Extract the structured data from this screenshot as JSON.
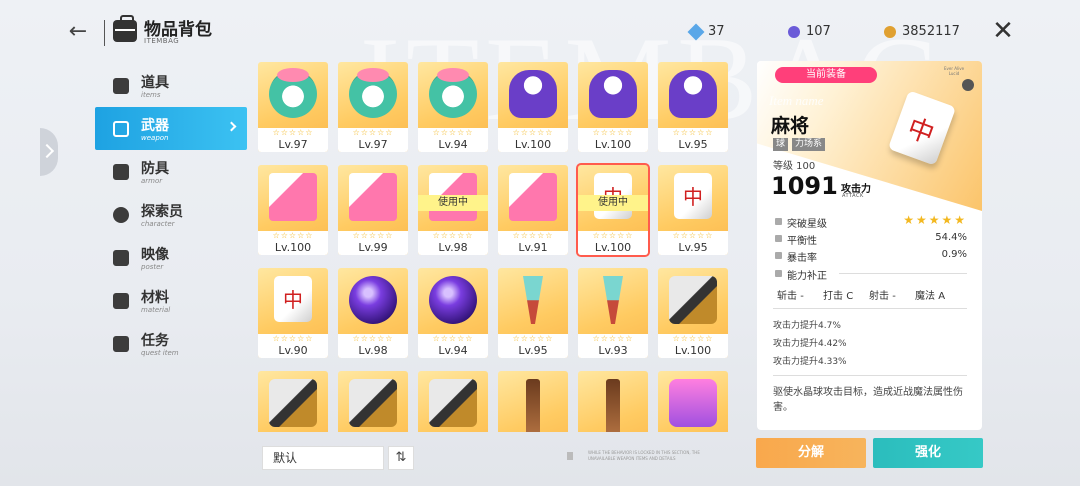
{
  "header": {
    "title": "物品背包",
    "subtitle": "ITEMBAG",
    "currency": [
      {
        "icon": "diamond-icon",
        "value": "37",
        "color": "#5aa7e8"
      },
      {
        "icon": "purple-orb-icon",
        "value": "107",
        "color": "#6b5bd8"
      },
      {
        "icon": "gold-coin-icon",
        "value": "3852117",
        "color": "#e0a030"
      }
    ]
  },
  "nav": [
    {
      "cn": "道具",
      "en": "items",
      "icon": "items-icon",
      "active": false
    },
    {
      "cn": "武器",
      "en": "weapon",
      "icon": "weapon-icon",
      "active": true
    },
    {
      "cn": "防具",
      "en": "armor",
      "icon": "armor-icon",
      "active": false
    },
    {
      "cn": "探索员",
      "en": "character",
      "icon": "character-icon",
      "active": false
    },
    {
      "cn": "映像",
      "en": "poster",
      "icon": "poster-icon",
      "active": false
    },
    {
      "cn": "材料",
      "en": "material",
      "icon": "material-icon",
      "active": false
    },
    {
      "cn": "任务",
      "en": "quest item",
      "icon": "quest-icon",
      "active": false
    }
  ],
  "items": [
    {
      "art": "pig",
      "lv": "Lv.97",
      "inuse": ""
    },
    {
      "art": "pig",
      "lv": "Lv.97",
      "inuse": ""
    },
    {
      "art": "pig",
      "lv": "Lv.94",
      "inuse": ""
    },
    {
      "art": "doll",
      "lv": "Lv.100",
      "inuse": ""
    },
    {
      "art": "doll",
      "lv": "Lv.100",
      "inuse": ""
    },
    {
      "art": "doll",
      "lv": "Lv.95",
      "inuse": ""
    },
    {
      "art": "cube",
      "lv": "Lv.100",
      "inuse": ""
    },
    {
      "art": "cube",
      "lv": "Lv.99",
      "inuse": ""
    },
    {
      "art": "cube",
      "lv": "Lv.98",
      "inuse": "使用中"
    },
    {
      "art": "cube",
      "lv": "Lv.91",
      "inuse": ""
    },
    {
      "art": "tile",
      "lv": "Lv.100",
      "inuse": "使用中",
      "selected": true
    },
    {
      "art": "tile",
      "lv": "Lv.95",
      "inuse": ""
    },
    {
      "art": "tile",
      "lv": "Lv.90",
      "inuse": ""
    },
    {
      "art": "orb",
      "lv": "Lv.98",
      "inuse": ""
    },
    {
      "art": "orb",
      "lv": "Lv.94",
      "inuse": ""
    },
    {
      "art": "wand",
      "lv": "Lv.95",
      "inuse": ""
    },
    {
      "art": "wand",
      "lv": "Lv.93",
      "inuse": ""
    },
    {
      "art": "horn",
      "lv": "Lv.100",
      "inuse": ""
    },
    {
      "art": "horn",
      "lv": "",
      "inuse": ""
    },
    {
      "art": "horn",
      "lv": "",
      "inuse": ""
    },
    {
      "art": "horn",
      "lv": "",
      "inuse": ""
    },
    {
      "art": "gun",
      "lv": "",
      "inuse": ""
    },
    {
      "art": "gun",
      "lv": "",
      "inuse": ""
    },
    {
      "art": "toy",
      "lv": "",
      "inuse": ""
    }
  ],
  "stars_text": "☆☆☆☆☆",
  "sort": {
    "label": "默认",
    "order_icon": "⇅"
  },
  "notice": "WHILE THE BEHAVIOR IS LOCKED IN THIS SECTION, THE UNAVAILABLE WEAPON ITEMS AND DETAILS",
  "detail": {
    "badge": "当前装备",
    "brand": "Ever Alive Lucid",
    "name_en": "Item name",
    "name": "麻将",
    "tags": [
      "球",
      "力场系"
    ],
    "level": "等级 100",
    "attack": "1091",
    "attack_label": "攻击力",
    "attack_en": "ATTACK",
    "stats": [
      {
        "name": "突破星级",
        "value": "★★★★★",
        "stars": true
      },
      {
        "name": "平衡性",
        "value": "54.4%"
      },
      {
        "name": "暴击率",
        "value": "0.9%"
      }
    ],
    "correction_title": "能力补正",
    "correction": [
      {
        "name": "斩击",
        "value": "-"
      },
      {
        "name": "打击",
        "value": "C"
      },
      {
        "name": "射击",
        "value": "-"
      },
      {
        "name": "魔法",
        "value": "A"
      }
    ],
    "bonuses": [
      "攻击力提升4.7%",
      "攻击力提升4.42%",
      "攻击力提升4.33%"
    ],
    "description": "驱使水晶球攻击目标，造成近战魔法属性伤害。"
  },
  "buttons": {
    "break": "分解",
    "enhance": "强化"
  },
  "colors": {
    "accent": "#1ea2e2",
    "badge": "#ff3f7a",
    "break": "#f9a84c",
    "enhance": "#2bbdbd",
    "star": "#f3b820"
  }
}
